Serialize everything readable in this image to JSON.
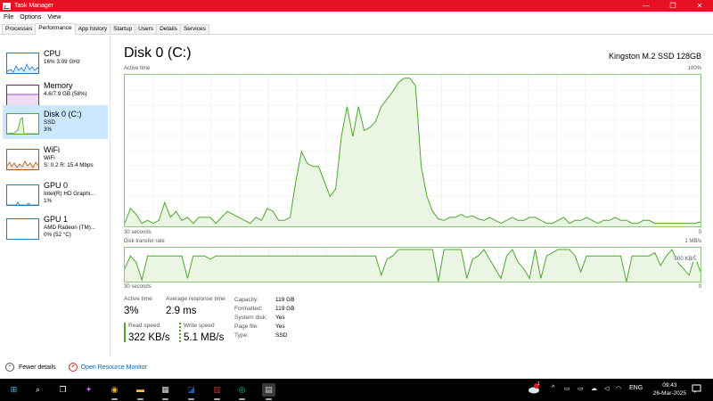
{
  "window": {
    "title": "Task Manager",
    "minimize": "—",
    "maximize": "❐",
    "close": "✕"
  },
  "menu": [
    "File",
    "Options",
    "View"
  ],
  "tabs": [
    "Processes",
    "Performance",
    "App history",
    "Startup",
    "Users",
    "Details",
    "Services"
  ],
  "sidebar": {
    "items": [
      {
        "name": "CPU",
        "line1": "16% 3.09 GHz",
        "line2": "",
        "color": "#1a7ac4"
      },
      {
        "name": "Memory",
        "line1": "4.6/7.9 GB (58%)",
        "line2": "",
        "color": "#8b12ae"
      },
      {
        "name": "Disk 0 (C:)",
        "line1": "SSD",
        "line2": "3%",
        "color": "#4ea72e"
      },
      {
        "name": "WiFi",
        "line1": "WiFi",
        "line2": "S: 0.2 R: 15.4 Mbps",
        "color": "#a75a1e"
      },
      {
        "name": "GPU 0",
        "line1": "Intel(R) HD Graphi...",
        "line2": "1%",
        "color": "#1a7ac4"
      },
      {
        "name": "GPU 1",
        "line1": "AMD Radeon (TM)...",
        "line2": "0% (52 °C)",
        "color": "#1a7ac4"
      }
    ]
  },
  "main": {
    "title": "Disk 0 (C:)",
    "device": "Kingston M.2 SSD 128GB",
    "active_time_graph": {
      "label": "Active time",
      "max_label": "100%",
      "time_left": "30 seconds",
      "time_right": "0",
      "values": [
        2,
        12,
        8,
        2,
        4,
        2,
        4,
        16,
        6,
        10,
        4,
        6,
        2,
        6,
        6,
        6,
        2,
        6,
        10,
        8,
        6,
        4,
        2,
        6,
        4,
        12,
        10,
        4,
        4,
        6,
        30,
        50,
        42,
        40,
        40,
        30,
        20,
        25,
        60,
        80,
        60,
        80,
        64,
        66,
        70,
        80,
        85,
        90,
        96,
        99,
        99,
        94,
        40,
        20,
        10,
        5,
        4,
        6,
        6,
        8,
        6,
        7,
        5,
        4,
        6,
        4,
        2,
        4,
        6,
        4,
        4,
        6,
        6,
        4,
        2,
        2,
        4,
        6,
        2,
        4,
        4,
        6,
        4,
        2,
        4,
        4,
        6,
        4,
        4,
        2,
        2,
        4,
        4,
        2,
        2,
        2,
        2,
        2,
        2,
        2,
        2,
        3
      ]
    },
    "transfer_graph": {
      "label": "Disk transfer rate",
      "max_label": "1 MB/s",
      "mid_label": "800 KB/s",
      "time_left": "30 seconds",
      "time_right": "0",
      "values": [
        40,
        80,
        60,
        5,
        80,
        80,
        80,
        80,
        80,
        80,
        80,
        10,
        80,
        80,
        80,
        70,
        80,
        80,
        80,
        80,
        80,
        80,
        80,
        80,
        80,
        80,
        80,
        80,
        80,
        80,
        80,
        80,
        80,
        80,
        80,
        80,
        80,
        80,
        80,
        80,
        80,
        80,
        80,
        80,
        80,
        20,
        70,
        80,
        100,
        100,
        100,
        100,
        100,
        100,
        100,
        0,
        100,
        100,
        100,
        100,
        10,
        70,
        80,
        100,
        70,
        40,
        10,
        80,
        100,
        60,
        40,
        10,
        100,
        10,
        80,
        90,
        100,
        100,
        100,
        80,
        30,
        80,
        80,
        80,
        80,
        80,
        80,
        80,
        0,
        80,
        80,
        80,
        80,
        90,
        50,
        80,
        100,
        60,
        40,
        20,
        80,
        30
      ]
    },
    "stats": {
      "active_time": {
        "label": "Active time",
        "value": "3%"
      },
      "avg_response": {
        "label": "Average response time",
        "value": "2.9 ms"
      },
      "read_speed": {
        "label": "Read speed",
        "value": "322 KB/s"
      },
      "write_speed": {
        "label": "Write speed",
        "value": "5.1 MB/s"
      },
      "details": [
        {
          "key": "Capacity:",
          "value": "119 GB"
        },
        {
          "key": "Formatted:",
          "value": "119 GB"
        },
        {
          "key": "System disk:",
          "value": "Yes"
        },
        {
          "key": "Page file:",
          "value": "Yes"
        },
        {
          "key": "Type:",
          "value": "SSD"
        }
      ]
    }
  },
  "footer": {
    "fewer_details": "Fewer details",
    "open_rm": "Open Resource Monitor"
  },
  "taskbar": {
    "apps": [
      {
        "name": "windows-start",
        "glyph": "⊞",
        "color": "#4cc2ff"
      },
      {
        "name": "search",
        "glyph": "⌕",
        "color": "#ffffff"
      },
      {
        "name": "task-view",
        "glyph": "❐",
        "color": "#ffffff"
      },
      {
        "name": "copilot",
        "glyph": "✦",
        "color": "#c56bff"
      },
      {
        "name": "chrome",
        "glyph": "◉",
        "color": "#f4b400"
      },
      {
        "name": "file-explorer",
        "glyph": "▬",
        "color": "#f8c13a"
      },
      {
        "name": "calculator",
        "glyph": "▦",
        "color": "#e0e0e0"
      },
      {
        "name": "outlook",
        "glyph": "◪",
        "color": "#0a64c2"
      },
      {
        "name": "winrar",
        "glyph": "▥",
        "color": "#b5372b"
      },
      {
        "name": "app-circle",
        "glyph": "◎",
        "color": "#1fb5a8"
      },
      {
        "name": "task-manager",
        "glyph": "▤",
        "color": "#d0d0d0"
      }
    ],
    "lang": "ENG",
    "time": "09:43",
    "date": "26-Mar-2025",
    "weather_badge": "1"
  }
}
